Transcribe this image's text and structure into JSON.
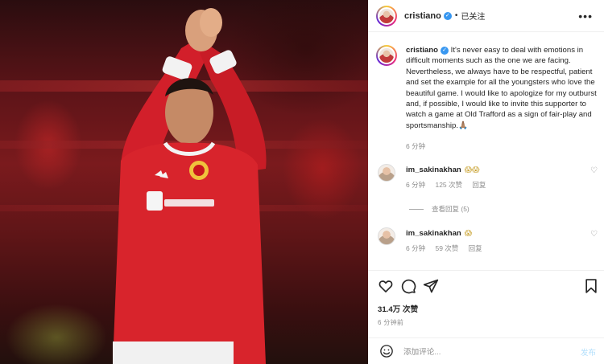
{
  "post": {
    "username": "cristiano",
    "verified": true,
    "separator": "•",
    "follow_status": "已关注",
    "more_icon": "more-horizontal-icon"
  },
  "caption": {
    "username": "cristiano",
    "text": "It's never easy to deal with emotions in difficult moments such as the one we are facing. Nevertheless, we always have to be respectful, patient and set the example for all the youngsters who love the beautiful game. I would like to apologize for my outburst and, if possible, I would like to invite this supporter to watch a game at Old Trafford as a sign of fair-play and sportsmanship.🙏🏽",
    "time": "6 分钟"
  },
  "comments": [
    {
      "username": "im_sakinakhan",
      "emoji": "😱😱",
      "time": "6 分钟",
      "likes": "125 次赞",
      "reply_label": "回复",
      "view_replies": "查看回复 (5)"
    },
    {
      "username": "im_sakinakhan",
      "emoji": "😱",
      "time": "6 分钟",
      "likes": "59 次赞",
      "reply_label": "回复"
    }
  ],
  "stats": {
    "likes": "31.4万 次赞",
    "time_ago": "6 分钟前"
  },
  "add_comment": {
    "placeholder": "添加评论...",
    "post_label": "发布"
  },
  "icons": [
    "heart-icon",
    "comment-icon",
    "share-icon",
    "bookmark-icon",
    "smile-icon",
    "verified-badge-icon"
  ],
  "colors": {
    "verified_blue": "#3897f0",
    "meta_gray": "#8e8e8e",
    "post_button_disabled": "#b2dffc",
    "jersey_red": "#d8242c"
  }
}
